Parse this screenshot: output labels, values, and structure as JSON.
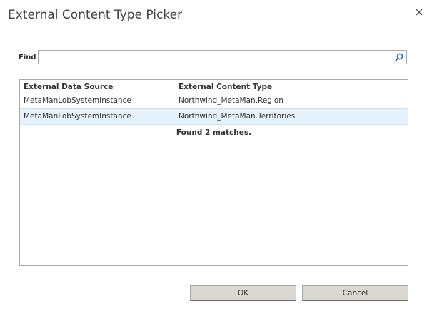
{
  "dialog": {
    "title": "External Content Type Picker",
    "close_icon": "close-icon"
  },
  "find": {
    "label": "Find",
    "value": "",
    "search_icon": "search-icon"
  },
  "results": {
    "columns": [
      "External Data Source",
      "External Content Type"
    ],
    "rows": [
      {
        "source": "MetaManLobSystemInstance",
        "type": "Northwind_MetaMan.Region",
        "selected": false
      },
      {
        "source": "MetaManLobSystemInstance",
        "type": "Northwind_MetaMan.Territories",
        "selected": true
      }
    ],
    "status": "Found 2 matches."
  },
  "buttons": {
    "ok": "OK",
    "cancel": "Cancel"
  },
  "colors": {
    "selected_row": "#e5f1fb",
    "search_icon": "#2a6bb5",
    "button_face": "#dcd8d0"
  }
}
